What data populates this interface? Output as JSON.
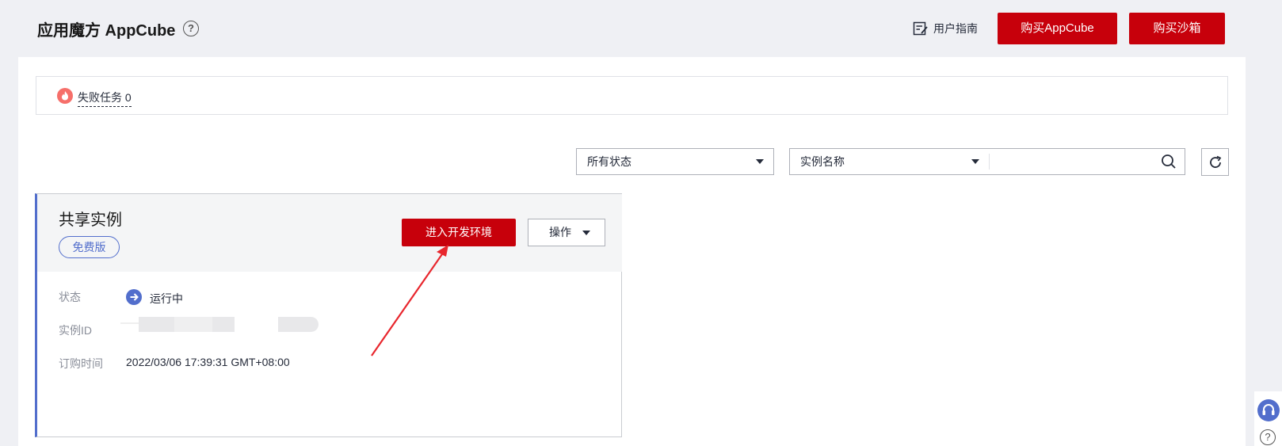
{
  "header": {
    "title": "应用魔方 AppCube",
    "help_glyph": "?",
    "user_guide": "用户指南",
    "buy_appcube": "购买AppCube",
    "buy_sandbox": "购买沙箱"
  },
  "alert": {
    "failed_tasks_label": "失败任务 0"
  },
  "filters": {
    "status_select": "所有状态",
    "field_select": "实例名称",
    "search_value": ""
  },
  "instance_card": {
    "title": "共享实例",
    "tag": "免费版",
    "enter_dev_button": "进入开发环境",
    "ops_button": "操作",
    "status_label": "状态",
    "status_value": "运行中",
    "id_label": "实例ID",
    "order_time_label": "订购时间",
    "order_time_value": "2022/03/06 17:39:31 GMT+08:00"
  },
  "float": {
    "help_glyph": "?"
  },
  "colors": {
    "brand_red": "#c7000b",
    "accent_blue": "#526ecc",
    "annotation_arrow": "#e8262d",
    "fail_icon": "#f66f6a"
  },
  "icons": [
    "question-circle-icon",
    "guide-doc-icon",
    "fire-icon",
    "search-icon",
    "refresh-icon",
    "arrow-right-circle-icon",
    "headset-icon"
  ]
}
